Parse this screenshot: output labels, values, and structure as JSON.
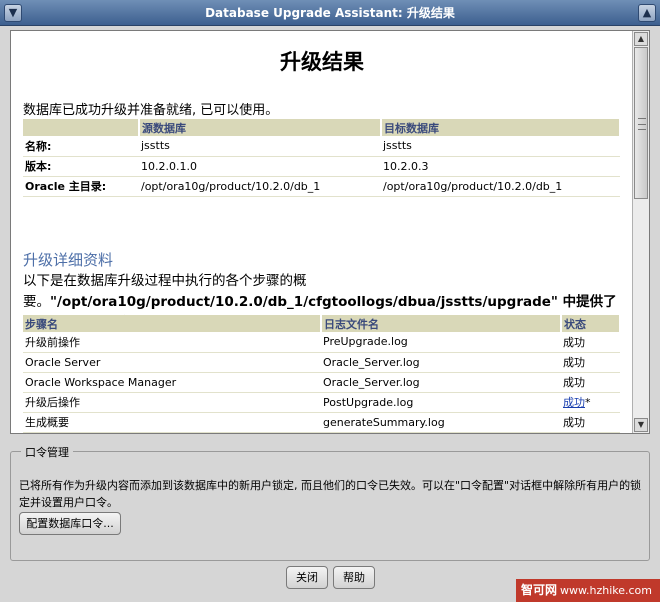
{
  "window": {
    "title": "Database Upgrade Assistant: 升级结果"
  },
  "page": {
    "title": "升级结果",
    "intro": "数据库已成功升级并准备就绪, 已可以使用。"
  },
  "summary_table": {
    "headers": [
      "",
      "源数据库",
      "目标数据库"
    ],
    "rows": [
      {
        "label": "名称:",
        "source": "jsstts",
        "target": "jsstts"
      },
      {
        "label": "版本:",
        "source": "10.2.0.1.0",
        "target": "10.2.0.3"
      },
      {
        "label": "Oracle 主目录:",
        "source": "/opt/ora10g/product/10.2.0/db_1",
        "target": "/opt/ora10g/product/10.2.0/db_1"
      }
    ]
  },
  "details": {
    "heading": "升级详细资料",
    "text_prefix": "以下是在数据库升级过程中执行的各个步骤的概要。",
    "path": "\"/opt/ora10g/product/10.2.0/db_1/cfgtoollogs/dbua/jsstts/upgrade\"",
    "text_suffix": " 中提供了所有步骤的日志文件以及此概要。"
  },
  "steps_table": {
    "headers": [
      "步骤名",
      "日志文件名",
      "状态"
    ],
    "rows": [
      {
        "step": "升级前操作",
        "log": "PreUpgrade.log",
        "status": "成功",
        "status_link": false,
        "mark": ""
      },
      {
        "step": "Oracle Server",
        "log": "Oracle_Server.log",
        "status": "成功",
        "status_link": false,
        "mark": ""
      },
      {
        "step": "Oracle Workspace Manager",
        "log": "Oracle_Server.log",
        "status": "成功",
        "status_link": false,
        "mark": ""
      },
      {
        "step": "升级后操作",
        "log": "PostUpgrade.log",
        "status": "成功",
        "status_link": true,
        "mark": "*"
      },
      {
        "step": "生成概要",
        "log": "generateSummary.log",
        "status": "成功",
        "status_link": false,
        "mark": ""
      }
    ]
  },
  "password_mgmt": {
    "legend": "口令管理",
    "description": "已将所有作为升级内容而添加到该数据库中的新用户锁定, 而且他们的口令已失效。可以在\"口令配置\"对话框中解除所有用户的锁定并设置用户口令。",
    "button": "配置数据库口令..."
  },
  "footer": {
    "close": "关闭",
    "help": "帮助"
  },
  "watermark": {
    "brand": "智可网",
    "url": "www.hzhike.com"
  },
  "colors": {
    "header_bg": "#d9d8b8",
    "header_text": "#3a4a7c",
    "section_heading": "#4d6fa8",
    "titlebar": "#3d5f8f"
  }
}
